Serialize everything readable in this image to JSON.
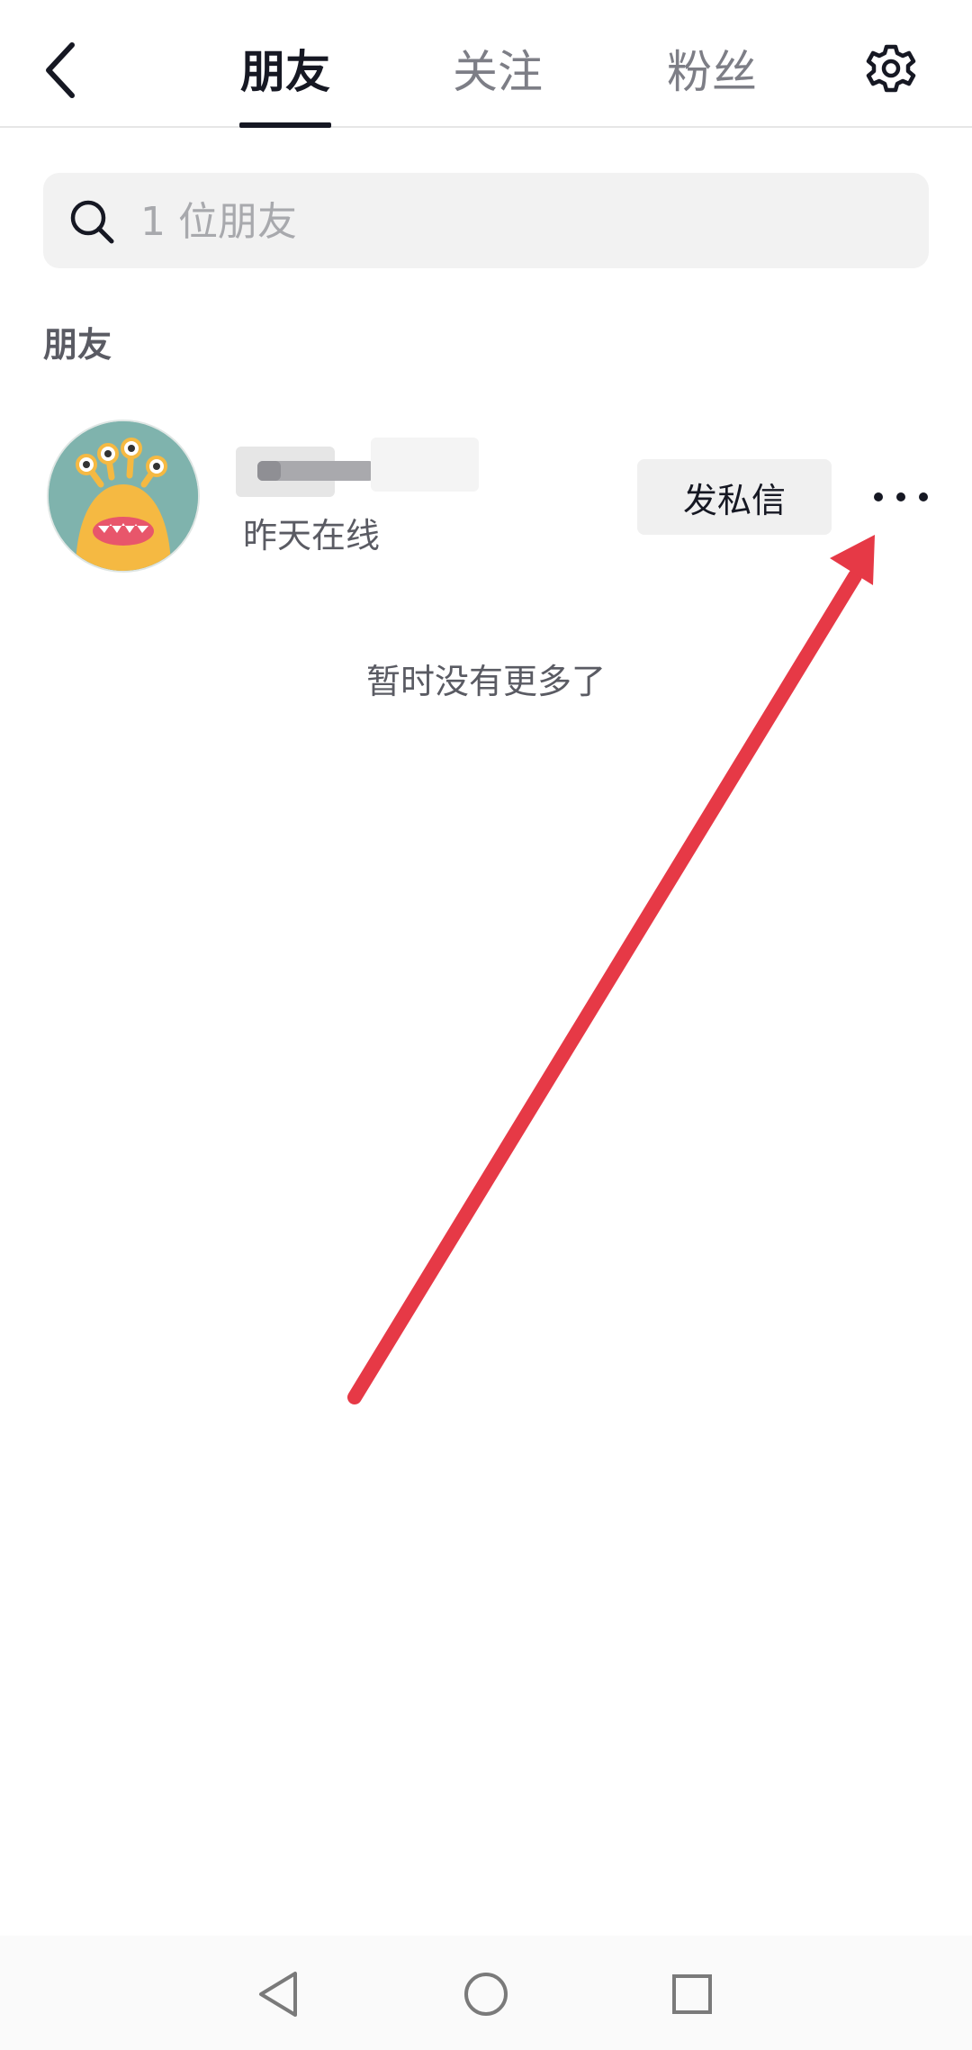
{
  "header": {
    "tabs": [
      {
        "label": "朋友",
        "active": true
      },
      {
        "label": "关注",
        "active": false
      },
      {
        "label": "粉丝",
        "active": false
      }
    ],
    "icons": {
      "back": "chevron-left-icon",
      "settings": "gear-icon"
    }
  },
  "search": {
    "placeholder": "1 位朋友",
    "value": "",
    "icon": "search-icon"
  },
  "section": {
    "title": "朋友"
  },
  "friends": [
    {
      "name": "",
      "status": "昨天在线",
      "action_label": "发私信",
      "more_icon": "more-horizontal-icon"
    }
  ],
  "footer": {
    "no_more_text": "暂时没有更多了"
  },
  "colors": {
    "primary_text": "#161823",
    "secondary_text": "#5a5b63",
    "inactive_tab": "#7d7e86",
    "search_bg": "#f2f2f2",
    "button_bg": "#f0f0f0",
    "annotation_arrow": "#e63946"
  },
  "navbar": {
    "icons": [
      "back-triangle-icon",
      "home-circle-icon",
      "recents-square-icon"
    ]
  }
}
